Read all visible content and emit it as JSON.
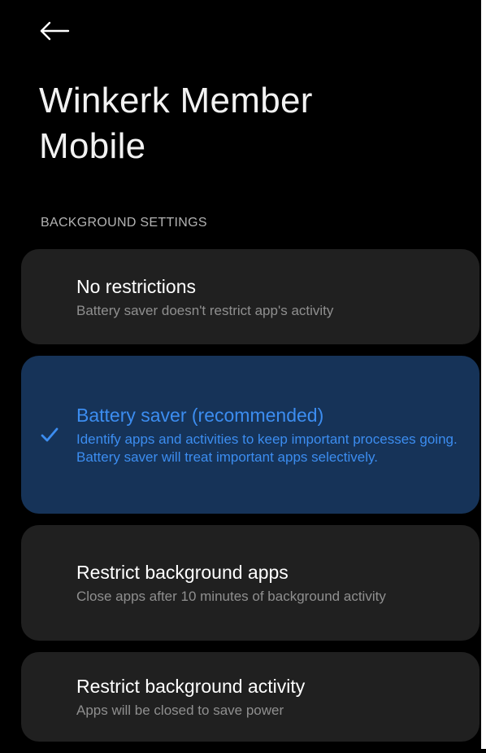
{
  "header": {
    "back_icon": "arrow-left-icon",
    "title": "Winkerk Member Mobile"
  },
  "section": {
    "label": "BACKGROUND SETTINGS"
  },
  "options": [
    {
      "title": "No restrictions",
      "description": "Battery saver doesn't restrict app's activity",
      "selected": false
    },
    {
      "title": "Battery saver (recommended)",
      "description_lines": [
        "Identify apps and activities to keep important processes going.",
        "Battery saver will treat important apps selectively."
      ],
      "selected": true,
      "selected_icon": "checkmark-icon"
    },
    {
      "title": "Restrict background apps",
      "description": "Close apps after 10 minutes of background activity",
      "selected": false
    },
    {
      "title": "Restrict background activity",
      "description": "Apps will be closed to save power",
      "selected": false
    }
  ],
  "colors": {
    "background": "#000000",
    "card": "#202020",
    "selected_card": "#163358",
    "accent": "#3c8df0",
    "secondary_text": "#8f8f8f"
  }
}
